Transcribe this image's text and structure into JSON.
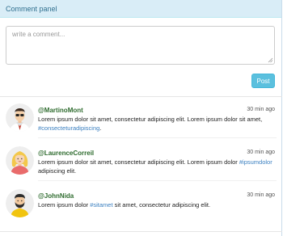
{
  "panel": {
    "title": "Comment panel"
  },
  "composer": {
    "placeholder": "write a comment...",
    "post_label": "Post"
  },
  "comments": [
    {
      "user": "@MartinoMont",
      "time": "30 min ago",
      "text_before": "Lorem ipsum dolor sit amet, consectetur adipiscing elit. Lorem ipsum dolor sit amet, ",
      "hashtag": "#consecteturadipiscing",
      "text_after": ".",
      "avatar": "man-with-glasses-avatar"
    },
    {
      "user": "@LaurenceCorreil",
      "time": "30 min ago",
      "text_before": "Lorem ipsum dolor sit amet, consectetur adipiscing elit. Lorem ipsum dolor ",
      "hashtag": "#ipsumdolor",
      "text_after": " adipiscing elit.",
      "avatar": "woman-blonde-avatar"
    },
    {
      "user": "@JohnNida",
      "time": "30 min ago",
      "text_before": "Lorem ipsum dolor ",
      "hashtag": "#sitamet",
      "text_after": " sit amet, consectetur adipiscing elit.",
      "avatar": "man-with-beard-avatar"
    }
  ],
  "colors": {
    "heading_bg": "#d9edf7",
    "heading_text": "#31708f",
    "post_button": "#5bc0de",
    "username": "#2e6b2e",
    "hashtag": "#3a7fc0"
  }
}
